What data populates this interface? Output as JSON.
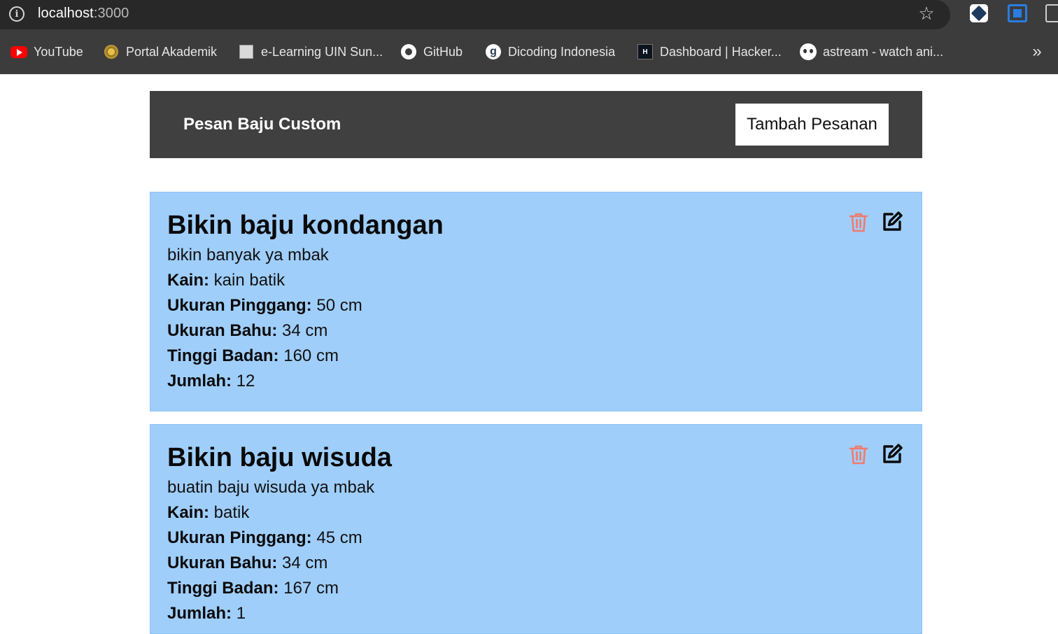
{
  "browser": {
    "url_host": "localhost",
    "url_port": ":3000",
    "bookmarks": [
      {
        "label": "YouTube",
        "icon": "youtube-icon"
      },
      {
        "label": "Portal Akademik",
        "icon": "portal-akademik-icon"
      },
      {
        "label": "e-Learning UIN Sun...",
        "icon": "elearning-icon"
      },
      {
        "label": "GitHub",
        "icon": "github-icon"
      },
      {
        "label": "Dicoding Indonesia",
        "icon": "dicoding-icon"
      },
      {
        "label": "Dashboard | Hacker...",
        "icon": "hackerrank-icon"
      },
      {
        "label": "astream - watch ani...",
        "icon": "astream-icon"
      }
    ],
    "more_bookmarks_glyph": "»"
  },
  "navbar": {
    "brand": "Pesan Baju Custom",
    "add_button_label": "Tambah Pesanan"
  },
  "colors": {
    "navbar_bg": "#404040",
    "card_bg": "#9fcefb",
    "trash_color": "#f07b6e",
    "edit_color": "#0a0a0a"
  },
  "orders": [
    {
      "title": "Bikin baju kondangan",
      "description": "bikin banyak ya mbak",
      "kain_label": "Kain:",
      "kain": "kain batik",
      "pinggang_label": "Ukuran Pinggang:",
      "pinggang": "50 cm",
      "bahu_label": "Ukuran Bahu:",
      "bahu": "34 cm",
      "tinggi_label": "Tinggi Badan:",
      "tinggi": "160 cm",
      "jumlah_label": "Jumlah:",
      "jumlah": "12"
    },
    {
      "title": "Bikin baju wisuda",
      "description": "buatin baju wisuda ya mbak",
      "kain_label": "Kain:",
      "kain": "batik",
      "pinggang_label": "Ukuran Pinggang:",
      "pinggang": "45 cm",
      "bahu_label": "Ukuran Bahu:",
      "bahu": "34 cm",
      "tinggi_label": "Tinggi Badan:",
      "tinggi": "167 cm",
      "jumlah_label": "Jumlah:",
      "jumlah": "1"
    }
  ]
}
